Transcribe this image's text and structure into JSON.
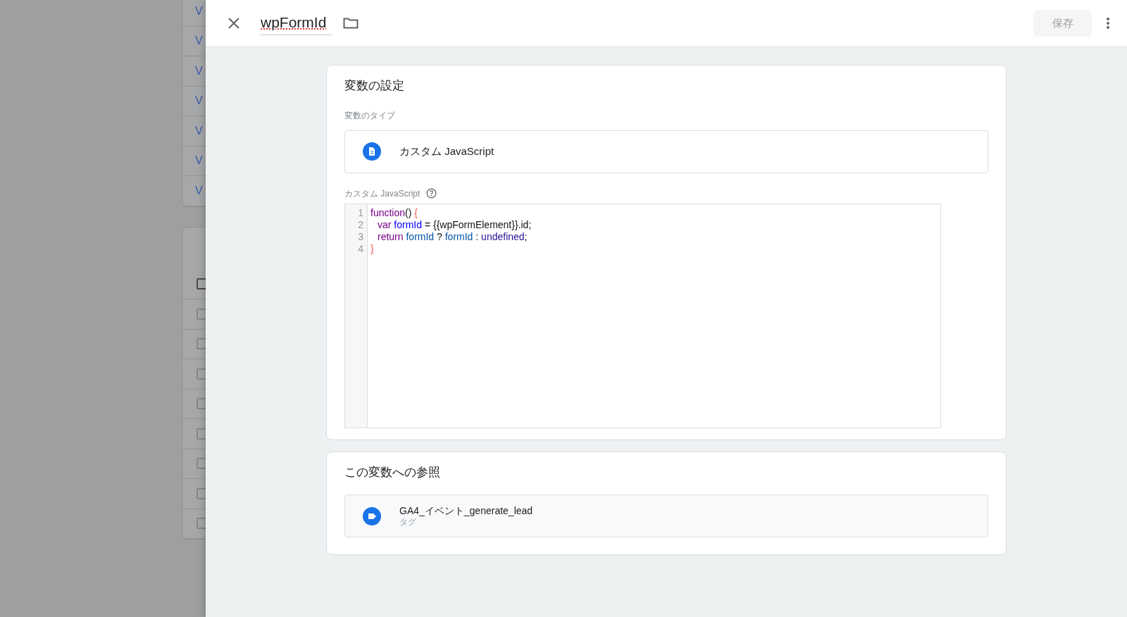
{
  "background_list": {
    "links": [
      "V",
      "V",
      "V",
      "V",
      "V",
      "V",
      "V"
    ],
    "rows": [
      {
        "checked": false
      },
      {
        "checked": false
      },
      {
        "checked": false
      },
      {
        "checked": false
      },
      {
        "checked": false
      },
      {
        "checked": false
      },
      {
        "checked": false
      },
      {
        "checked": false
      },
      {
        "checked": false
      }
    ]
  },
  "header": {
    "title": "wpFormId",
    "save_button": {
      "label": "保存",
      "disabled": true
    }
  },
  "config_card": {
    "title": "変数の設定",
    "type_label": "変数のタイプ",
    "type_value": "カスタム JavaScript",
    "code_label": "カスタム JavaScript",
    "code_lines": [
      {
        "number": "1",
        "tokens": [
          {
            "kind": "keyword",
            "text": "function"
          },
          {
            "kind": "plain",
            "text": "() "
          },
          {
            "kind": "bracket",
            "text": "{"
          }
        ]
      },
      {
        "number": "2",
        "indented": true,
        "tokens": [
          {
            "kind": "keyword",
            "text": "var"
          },
          {
            "kind": "def",
            "text": " formId"
          },
          {
            "kind": "plain",
            "text": " = {{wpFormElement}}.id;"
          }
        ]
      },
      {
        "number": "3",
        "indented": true,
        "tokens": [
          {
            "kind": "keyword",
            "text": "return"
          },
          {
            "kind": "variable",
            "text": " formId"
          },
          {
            "kind": "plain",
            "text": " ? "
          },
          {
            "kind": "variable",
            "text": "formId"
          },
          {
            "kind": "plain",
            "text": " : "
          },
          {
            "kind": "atom",
            "text": "undefined"
          },
          {
            "kind": "plain",
            "text": ";"
          }
        ]
      },
      {
        "number": "4",
        "tokens": [
          {
            "kind": "bracket",
            "text": "}"
          }
        ]
      }
    ]
  },
  "references_card": {
    "title": "この変数への参照",
    "items": [
      {
        "name": "GA4_イベント_generate_lead",
        "type": "タグ"
      }
    ]
  }
}
